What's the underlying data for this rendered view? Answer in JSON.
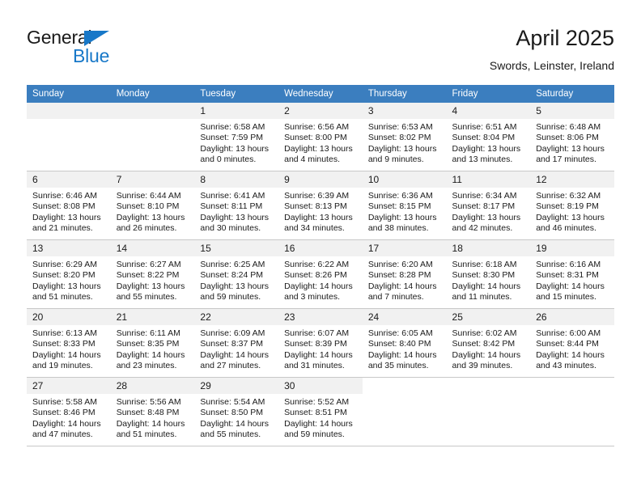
{
  "brand": {
    "line1": "General",
    "line2": "Blue",
    "accent_color": "#1878c8"
  },
  "header": {
    "title": "April 2025",
    "subtitle": "Swords, Leinster, Ireland"
  },
  "calendar": {
    "header_bg": "#3b7ebf",
    "daynum_bg": "#f1f1f1",
    "weekdays": [
      "Sunday",
      "Monday",
      "Tuesday",
      "Wednesday",
      "Thursday",
      "Friday",
      "Saturday"
    ],
    "weeks": [
      [
        {
          "day": "",
          "blank": true
        },
        {
          "day": "",
          "blank": true
        },
        {
          "day": "1",
          "sunrise": "Sunrise: 6:58 AM",
          "sunset": "Sunset: 7:59 PM",
          "daylight_1": "Daylight: 13 hours",
          "daylight_2": "and 0 minutes."
        },
        {
          "day": "2",
          "sunrise": "Sunrise: 6:56 AM",
          "sunset": "Sunset: 8:00 PM",
          "daylight_1": "Daylight: 13 hours",
          "daylight_2": "and 4 minutes."
        },
        {
          "day": "3",
          "sunrise": "Sunrise: 6:53 AM",
          "sunset": "Sunset: 8:02 PM",
          "daylight_1": "Daylight: 13 hours",
          "daylight_2": "and 9 minutes."
        },
        {
          "day": "4",
          "sunrise": "Sunrise: 6:51 AM",
          "sunset": "Sunset: 8:04 PM",
          "daylight_1": "Daylight: 13 hours",
          "daylight_2": "and 13 minutes."
        },
        {
          "day": "5",
          "sunrise": "Sunrise: 6:48 AM",
          "sunset": "Sunset: 8:06 PM",
          "daylight_1": "Daylight: 13 hours",
          "daylight_2": "and 17 minutes."
        }
      ],
      [
        {
          "day": "6",
          "sunrise": "Sunrise: 6:46 AM",
          "sunset": "Sunset: 8:08 PM",
          "daylight_1": "Daylight: 13 hours",
          "daylight_2": "and 21 minutes."
        },
        {
          "day": "7",
          "sunrise": "Sunrise: 6:44 AM",
          "sunset": "Sunset: 8:10 PM",
          "daylight_1": "Daylight: 13 hours",
          "daylight_2": "and 26 minutes."
        },
        {
          "day": "8",
          "sunrise": "Sunrise: 6:41 AM",
          "sunset": "Sunset: 8:11 PM",
          "daylight_1": "Daylight: 13 hours",
          "daylight_2": "and 30 minutes."
        },
        {
          "day": "9",
          "sunrise": "Sunrise: 6:39 AM",
          "sunset": "Sunset: 8:13 PM",
          "daylight_1": "Daylight: 13 hours",
          "daylight_2": "and 34 minutes."
        },
        {
          "day": "10",
          "sunrise": "Sunrise: 6:36 AM",
          "sunset": "Sunset: 8:15 PM",
          "daylight_1": "Daylight: 13 hours",
          "daylight_2": "and 38 minutes."
        },
        {
          "day": "11",
          "sunrise": "Sunrise: 6:34 AM",
          "sunset": "Sunset: 8:17 PM",
          "daylight_1": "Daylight: 13 hours",
          "daylight_2": "and 42 minutes."
        },
        {
          "day": "12",
          "sunrise": "Sunrise: 6:32 AM",
          "sunset": "Sunset: 8:19 PM",
          "daylight_1": "Daylight: 13 hours",
          "daylight_2": "and 46 minutes."
        }
      ],
      [
        {
          "day": "13",
          "sunrise": "Sunrise: 6:29 AM",
          "sunset": "Sunset: 8:20 PM",
          "daylight_1": "Daylight: 13 hours",
          "daylight_2": "and 51 minutes."
        },
        {
          "day": "14",
          "sunrise": "Sunrise: 6:27 AM",
          "sunset": "Sunset: 8:22 PM",
          "daylight_1": "Daylight: 13 hours",
          "daylight_2": "and 55 minutes."
        },
        {
          "day": "15",
          "sunrise": "Sunrise: 6:25 AM",
          "sunset": "Sunset: 8:24 PM",
          "daylight_1": "Daylight: 13 hours",
          "daylight_2": "and 59 minutes."
        },
        {
          "day": "16",
          "sunrise": "Sunrise: 6:22 AM",
          "sunset": "Sunset: 8:26 PM",
          "daylight_1": "Daylight: 14 hours",
          "daylight_2": "and 3 minutes."
        },
        {
          "day": "17",
          "sunrise": "Sunrise: 6:20 AM",
          "sunset": "Sunset: 8:28 PM",
          "daylight_1": "Daylight: 14 hours",
          "daylight_2": "and 7 minutes."
        },
        {
          "day": "18",
          "sunrise": "Sunrise: 6:18 AM",
          "sunset": "Sunset: 8:30 PM",
          "daylight_1": "Daylight: 14 hours",
          "daylight_2": "and 11 minutes."
        },
        {
          "day": "19",
          "sunrise": "Sunrise: 6:16 AM",
          "sunset": "Sunset: 8:31 PM",
          "daylight_1": "Daylight: 14 hours",
          "daylight_2": "and 15 minutes."
        }
      ],
      [
        {
          "day": "20",
          "sunrise": "Sunrise: 6:13 AM",
          "sunset": "Sunset: 8:33 PM",
          "daylight_1": "Daylight: 14 hours",
          "daylight_2": "and 19 minutes."
        },
        {
          "day": "21",
          "sunrise": "Sunrise: 6:11 AM",
          "sunset": "Sunset: 8:35 PM",
          "daylight_1": "Daylight: 14 hours",
          "daylight_2": "and 23 minutes."
        },
        {
          "day": "22",
          "sunrise": "Sunrise: 6:09 AM",
          "sunset": "Sunset: 8:37 PM",
          "daylight_1": "Daylight: 14 hours",
          "daylight_2": "and 27 minutes."
        },
        {
          "day": "23",
          "sunrise": "Sunrise: 6:07 AM",
          "sunset": "Sunset: 8:39 PM",
          "daylight_1": "Daylight: 14 hours",
          "daylight_2": "and 31 minutes."
        },
        {
          "day": "24",
          "sunrise": "Sunrise: 6:05 AM",
          "sunset": "Sunset: 8:40 PM",
          "daylight_1": "Daylight: 14 hours",
          "daylight_2": "and 35 minutes."
        },
        {
          "day": "25",
          "sunrise": "Sunrise: 6:02 AM",
          "sunset": "Sunset: 8:42 PM",
          "daylight_1": "Daylight: 14 hours",
          "daylight_2": "and 39 minutes."
        },
        {
          "day": "26",
          "sunrise": "Sunrise: 6:00 AM",
          "sunset": "Sunset: 8:44 PM",
          "daylight_1": "Daylight: 14 hours",
          "daylight_2": "and 43 minutes."
        }
      ],
      [
        {
          "day": "27",
          "sunrise": "Sunrise: 5:58 AM",
          "sunset": "Sunset: 8:46 PM",
          "daylight_1": "Daylight: 14 hours",
          "daylight_2": "and 47 minutes."
        },
        {
          "day": "28",
          "sunrise": "Sunrise: 5:56 AM",
          "sunset": "Sunset: 8:48 PM",
          "daylight_1": "Daylight: 14 hours",
          "daylight_2": "and 51 minutes."
        },
        {
          "day": "29",
          "sunrise": "Sunrise: 5:54 AM",
          "sunset": "Sunset: 8:50 PM",
          "daylight_1": "Daylight: 14 hours",
          "daylight_2": "and 55 minutes."
        },
        {
          "day": "30",
          "sunrise": "Sunrise: 5:52 AM",
          "sunset": "Sunset: 8:51 PM",
          "daylight_1": "Daylight: 14 hours",
          "daylight_2": "and 59 minutes."
        },
        {
          "day": "",
          "blank": true,
          "trailing": true
        },
        {
          "day": "",
          "blank": true,
          "trailing": true
        },
        {
          "day": "",
          "blank": true,
          "trailing": true
        }
      ]
    ]
  }
}
